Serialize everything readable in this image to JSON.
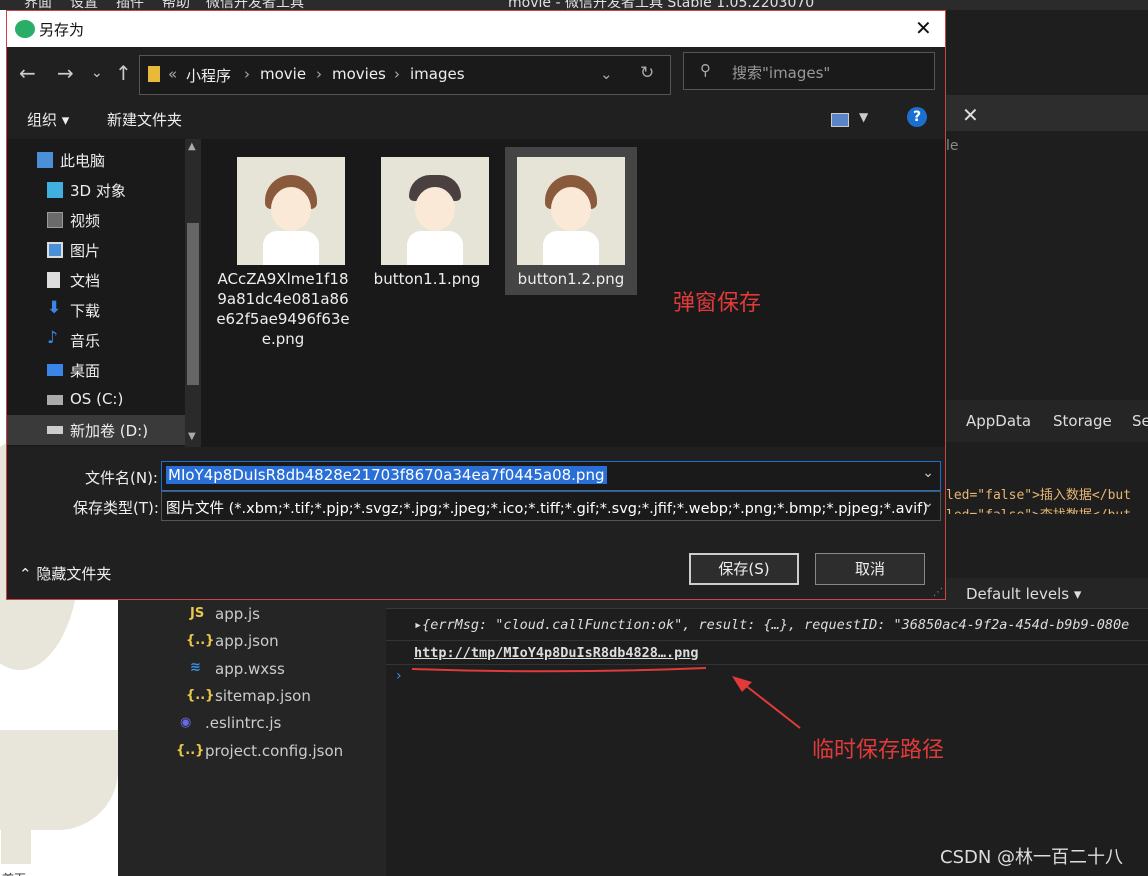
{
  "ide": {
    "menu": [
      "界面",
      "设置",
      "插件",
      "帮助",
      "微信开发者工具"
    ],
    "title": "movie - 微信开发者工具 Stable 1.05.2203070",
    "tab_fragment": "le",
    "devtools_tabs": [
      "AppData",
      "Storage",
      "Se"
    ],
    "wxml_line1": "led=\"false\">插入数据</but",
    "wxml_line2": "led=\"false\">查找数据</but",
    "console_levels": "Default levels ▾",
    "console_line1": "▸{errMsg: \"cloud.callFunction:ok\", result: {…}, requestID: \"36850ac4-9f2a-454d-b9b9-080e",
    "console_line2": "http://tmp/MIoY4p8DuIsR8db4828….png",
    "console_prompt": "›",
    "home_label": "首页",
    "files": [
      {
        "icon": "JS",
        "name": "app.js"
      },
      {
        "icon": "{..}",
        "name": "app.json"
      },
      {
        "icon": "≋",
        "name": "app.wxss"
      },
      {
        "icon": "{..}",
        "name": "sitemap.json"
      },
      {
        "icon": "◉",
        "name": ".eslintrc.js"
      },
      {
        "icon": "{..}",
        "name": "project.config.json"
      }
    ]
  },
  "dialog": {
    "title": "另存为",
    "close": "✕",
    "nav": {
      "back": "←",
      "forward": "→",
      "recent": "⌄",
      "up": "↑",
      "refresh": "↻"
    },
    "breadcrumb": [
      "«",
      "小程序",
      "›",
      "movie",
      "›",
      "movies",
      "›",
      "images"
    ],
    "breadcrumb_dropdown": "⌄",
    "search_placeholder": "搜索\"images\"",
    "organize": "组织 ▾",
    "new_folder": "新建文件夹",
    "help": "?",
    "nav_items": [
      {
        "label": "此电脑",
        "icon": "pc-icon",
        "color": "#4a8fd8"
      },
      {
        "label": "3D 对象",
        "icon": "cube-icon",
        "color": "#3fb0e0"
      },
      {
        "label": "视频",
        "icon": "video-icon",
        "color": "#6a6a6a"
      },
      {
        "label": "图片",
        "icon": "picture-icon",
        "color": "#4a8fd8"
      },
      {
        "label": "文档",
        "icon": "document-icon",
        "color": "#dddddd"
      },
      {
        "label": "下载",
        "icon": "download-icon",
        "color": "#3a86e8"
      },
      {
        "label": "音乐",
        "icon": "music-icon",
        "color": "#3a86e8"
      },
      {
        "label": "桌面",
        "icon": "desktop-icon",
        "color": "#3a86e8"
      },
      {
        "label": "OS (C:)",
        "icon": "drive-icon",
        "color": "#aaaaaa"
      },
      {
        "label": "新加卷 (D:)",
        "icon": "drive-icon",
        "color": "#aaaaaa"
      }
    ],
    "files": [
      {
        "name": "ACcZA9Xlme1f189a81dc4e081a86e62f5ae9496f63ee.png",
        "hair": "#8a5a3c"
      },
      {
        "name": "button1.1.png",
        "hair": "#4a4040"
      },
      {
        "name": "button1.2.png",
        "hair": "#8a5a3c"
      }
    ],
    "filename_label": "文件名(N):",
    "filename_value": "MIoY4p8DuIsR8db4828e21703f8670a34ea7f0445a08.png",
    "type_label": "保存类型(T):",
    "type_value": "图片文件 (*.xbm;*.tif;*.pjp;*.svgz;*.jpg;*.jpeg;*.ico;*.tiff;*.gif;*.svg;*.jfif;*.webp;*.png;*.bmp;*.pjpeg;*.avif)",
    "hide_folders": "⌃  隐藏文件夹",
    "save": "保存(S)",
    "cancel": "取消"
  },
  "annotations": {
    "popup_save": "弹窗保存",
    "temp_path": "临时保存路径",
    "color": "#e03a3a"
  },
  "watermark": "CSDN @林一百二十八"
}
